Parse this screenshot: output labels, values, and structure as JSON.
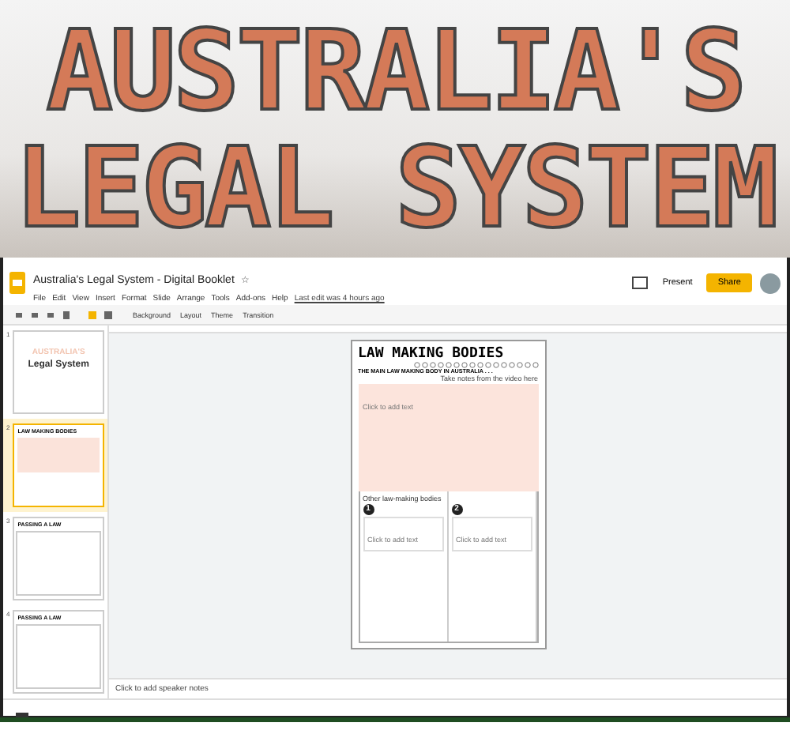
{
  "banner": {
    "lines": [
      "AUSTRALIA'S",
      "LEGAL SYSTEM"
    ]
  },
  "doc": {
    "title": "Australia's Legal System - Digital Booklet",
    "star": "☆",
    "last_edit": "Last edit was 4 hours ago"
  },
  "menu": [
    "File",
    "Edit",
    "View",
    "Insert",
    "Format",
    "Slide",
    "Arrange",
    "Tools",
    "Add-ons",
    "Help"
  ],
  "toolbar": [
    "Background",
    "Layout",
    "Theme",
    "Transition"
  ],
  "present": "Present",
  "share": "Share",
  "slides": [
    {
      "number": "1",
      "selected": false,
      "kind": "cover",
      "title": "AUSTRALIA'S",
      "subtitle": "Legal System"
    },
    {
      "number": "2",
      "selected": true,
      "kind": "bodies",
      "title": "LAW MAKING BODIES"
    },
    {
      "number": "3",
      "selected": false,
      "kind": "list",
      "title": "PASSING A LAW"
    },
    {
      "number": "4",
      "selected": false,
      "kind": "list",
      "title": "PASSING A LAW"
    }
  ],
  "page": {
    "title": "LAW MAKING BODIES",
    "question": "THE MAIN LAW MAKING BODY IN AUSTRALIA . . .",
    "hint": "Take notes from the video here",
    "main_placeholder": "Click to add text",
    "others_label": "Other law-making bodies",
    "boxes": [
      {
        "number": "1",
        "placeholder": "Click to add text"
      },
      {
        "number": "2",
        "placeholder": "Click to add text"
      }
    ]
  },
  "speaker_notes": {
    "placeholder": "Click to add speaker notes"
  }
}
